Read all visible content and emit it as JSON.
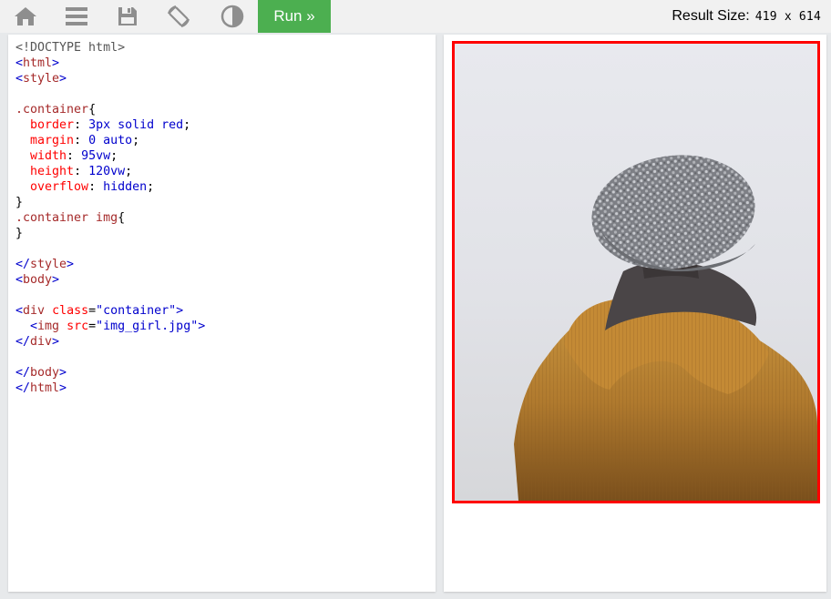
{
  "toolbar": {
    "icons": [
      "home-icon",
      "menu-icon",
      "save-icon",
      "rotate-icon",
      "theme-icon"
    ],
    "run_label": "Run »",
    "result_size_label": "Result Size:",
    "result_size_value": "419 x 614"
  },
  "colors": {
    "run_button": "#4caf50",
    "tag": "#0000cd",
    "tag_name": "#a52a2a",
    "attribute": "#ff0000",
    "container_border": "#ff0000"
  },
  "code": {
    "doctype": "<!DOCTYPE html>",
    "tag_html": "html",
    "tag_style": "style",
    "selector_container": ".container",
    "selector_container_img": ".container img",
    "props": [
      {
        "name": "border",
        "value": "3px solid red"
      },
      {
        "name": "margin",
        "value": "0 auto"
      },
      {
        "name": "width",
        "value": "95vw"
      },
      {
        "name": "height",
        "value": "120vw"
      },
      {
        "name": "overflow",
        "value": "hidden"
      }
    ],
    "tag_body": "body",
    "tag_div": "div",
    "attr_class": "class",
    "class_value": "\"container\"",
    "tag_img": "img",
    "attr_src": "src",
    "src_value": "\"img_girl.jpg\""
  },
  "result": {
    "image_icon": "girl-in-hat-photo"
  }
}
